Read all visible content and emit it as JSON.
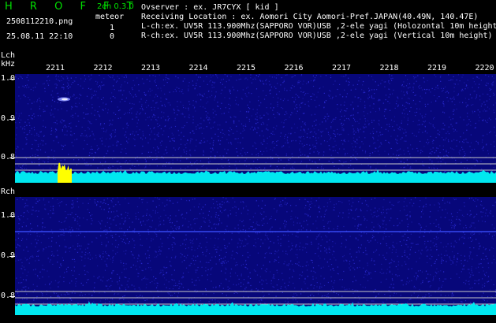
{
  "header": {
    "title": "H R O F F T",
    "filename": "2508112210.png",
    "datetime": "25.08.11 22:10",
    "version": "2ch 0.3.0",
    "meteor_label": "meteor",
    "lch_count": "1",
    "rch_count": "0"
  },
  "station": {
    "observer": "Ovserver             : ex. JR7CYX [ kid ]",
    "location": "Receiving Location : ex. Aomori City Aomori-Pref.JAPAN(40.49N, 140.47E)",
    "lch": "L-ch:ex. UV5R 113.900Mhz(SAPPORO VOR)USB ,2-ele yagi (Holozontal 10m height)",
    "rch": "R-ch:ex. UV5R 113.900Mhz(SAPPORO VOR)USB ,2-ele yagi (Vertical 10m height)"
  },
  "axes": {
    "lch_label": "Lch",
    "khz_label": "kHz",
    "rch_label": "Rch",
    "times": [
      "2211",
      "2212",
      "2213",
      "2214",
      "2215",
      "2216",
      "2217",
      "2218",
      "2219",
      "2220"
    ],
    "lch_ticks": [
      "1.0",
      "0.9",
      "0.8"
    ],
    "rch_ticks": [
      "1.0",
      "0.9",
      "0.8"
    ]
  },
  "colors": {
    "background": "#000000",
    "waterfall_bg": "#07077a",
    "noise": "#2a2ad0",
    "spectrum": "#00e8f0",
    "meteor": "#ffff00",
    "title_green": "#00e000"
  }
}
